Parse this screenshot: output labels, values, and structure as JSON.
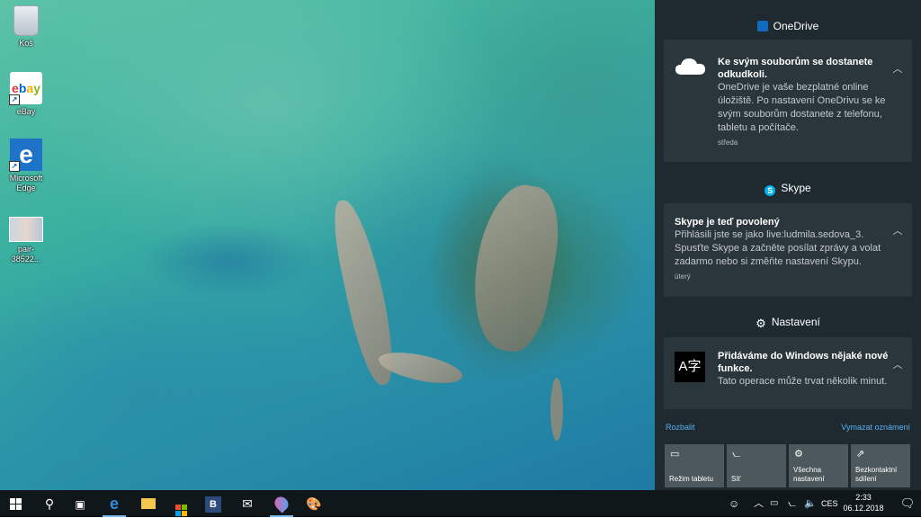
{
  "desktop": {
    "icons": [
      {
        "label": "Koš",
        "icon": "recycle-bin-icon"
      },
      {
        "label": "eBay",
        "icon": "ebay-icon",
        "logo": [
          "e",
          "b",
          "a",
          "y"
        ]
      },
      {
        "label": "Microsoft Edge",
        "icon": "edge-icon"
      },
      {
        "label": "pair-38522...",
        "icon": "photo-icon"
      }
    ]
  },
  "action_center": {
    "groups": [
      {
        "name": "OneDrive",
        "icon": "onedrive-icon",
        "notification": {
          "title": "Ke svým souborům se dostanete odkudkoli.",
          "body": "OneDrive je vaše bezplatné online úložiště. Po nastavení OneDrivu se ke svým souborům dostanete z telefonu, tabletu a počítače.",
          "time": "středa",
          "icon": "cloud-icon"
        }
      },
      {
        "name": "Skype",
        "icon": "skype-icon",
        "notification": {
          "title": "Skype je teď povolený",
          "body": "Přihlásili jste se jako live:ludmila.sedova_3. Spusťte Skype a začněte posílat zprávy a volat zadarmo nebo si změňte nastavení Skypu.",
          "time": "úterý"
        }
      },
      {
        "name": "Nastavení",
        "icon": "gear-icon",
        "notification": {
          "title": "Přidáváme do Windows nějaké nové funkce.",
          "body": "Tato operace může trvat několik minut.",
          "icon": "language-icon",
          "icon_glyph": "A字"
        }
      }
    ],
    "expand_label": "Rozbalit",
    "clear_label": "Vymazat oznámení",
    "quick_actions": [
      {
        "label": "Režim tabletu",
        "icon": "tablet-mode-icon"
      },
      {
        "label": "Síť",
        "icon": "network-icon"
      },
      {
        "label": "Všechna nastavení",
        "icon": "settings-icon"
      },
      {
        "label": "Bezkontaktní sdílení",
        "icon": "nearby-sharing-icon"
      }
    ]
  },
  "taskbar": {
    "apps": [
      "start",
      "search",
      "task-view",
      "edge",
      "file-explorer",
      "store",
      "b-app",
      "mail",
      "paint-3d",
      "paint"
    ],
    "b_app_label": "B",
    "language": "CES",
    "time": "2:33",
    "date": "06.12.2018"
  },
  "colors": {
    "panel_bg": "#1f2a30",
    "card_bg": "#2a363c",
    "tile_bg": "#4d585d",
    "link": "#5ab0f5",
    "taskbar_bg": "#10171b"
  }
}
